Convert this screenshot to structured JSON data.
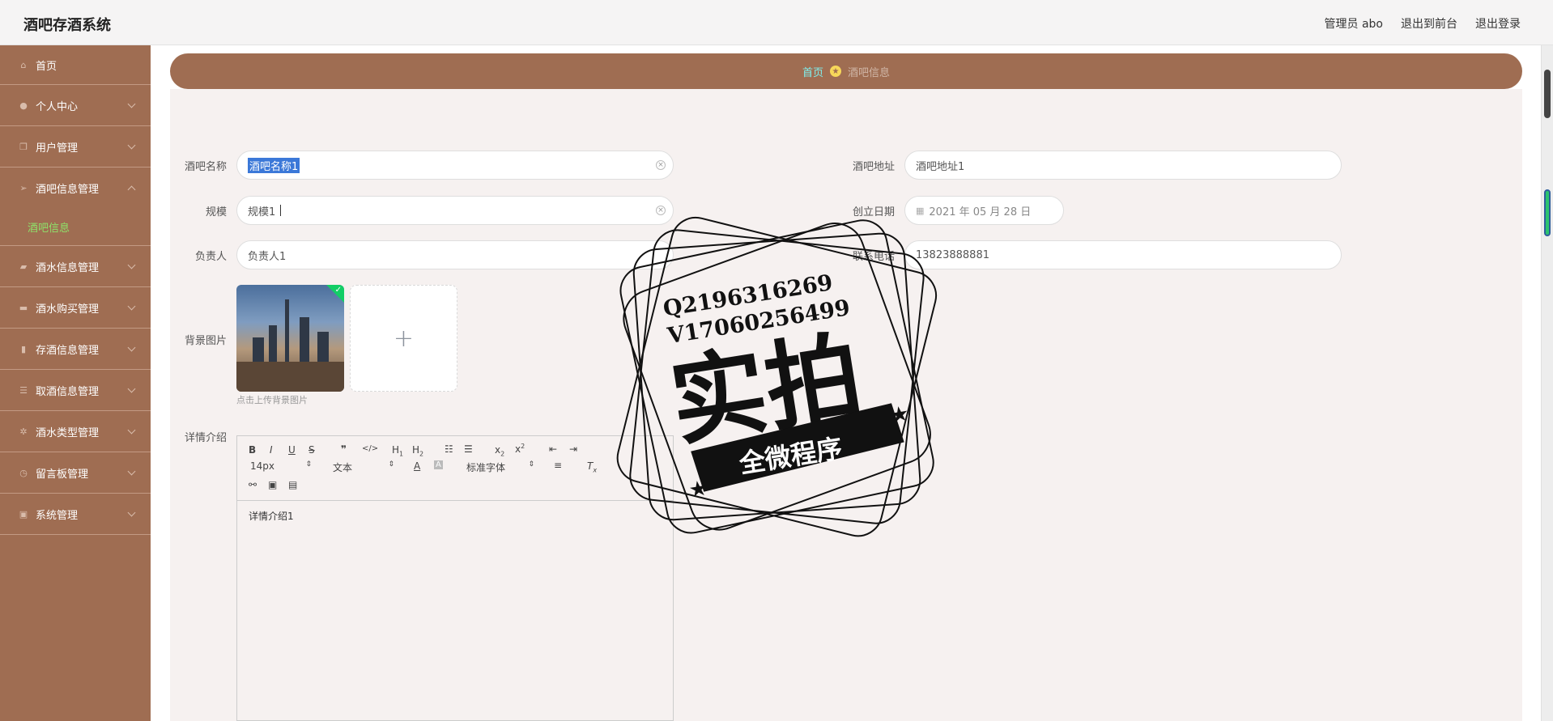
{
  "app": {
    "title": "酒吧存酒系统"
  },
  "header": {
    "user_label": "管理员 abo",
    "front_link": "退出到前台",
    "logout_link": "退出登录"
  },
  "sidebar": {
    "items": [
      {
        "label": "首页",
        "icon": "home-icon"
      },
      {
        "label": "个人中心",
        "icon": "user-icon"
      },
      {
        "label": "用户管理",
        "icon": "copy-icon"
      },
      {
        "label": "酒吧信息管理",
        "icon": "send-icon",
        "expanded": true
      },
      {
        "label": "酒水信息管理",
        "icon": "thumb-icon"
      },
      {
        "label": "酒水购买管理",
        "icon": "bag-icon"
      },
      {
        "label": "存酒信息管理",
        "icon": "bottle-icon"
      },
      {
        "label": "取酒信息管理",
        "icon": "sliders-icon"
      },
      {
        "label": "酒水类型管理",
        "icon": "settings-icon"
      },
      {
        "label": "留言板管理",
        "icon": "clock-icon"
      },
      {
        "label": "系统管理",
        "icon": "image-icon"
      }
    ],
    "sub_item": "酒吧信息"
  },
  "breadcrumb": {
    "home": "首页",
    "current": "酒吧信息"
  },
  "form": {
    "name_label": "酒吧名称",
    "name_value": "酒吧名称1",
    "address_label": "酒吧地址",
    "address_value": "酒吧地址1",
    "scale_label": "规模",
    "scale_value": "规模1",
    "date_label": "创立日期",
    "date_value": "2021 年 05 月 28 日",
    "manager_label": "负责人",
    "manager_value": "负责人1",
    "phone_label": "联系电话",
    "phone_value": "13823888881",
    "image_label": "背景图片",
    "image_hint": "点击上传背景图片",
    "detail_label": "详情介绍",
    "detail_value": "详情介绍1"
  },
  "editor_toolbar": {
    "font_size": "14px",
    "paragraph": "文本",
    "font_family": "标准字体"
  },
  "watermark": {
    "line1": "Q2196316269",
    "line2": "V17060256499",
    "main": "实拍",
    "banner": "全微程序"
  }
}
